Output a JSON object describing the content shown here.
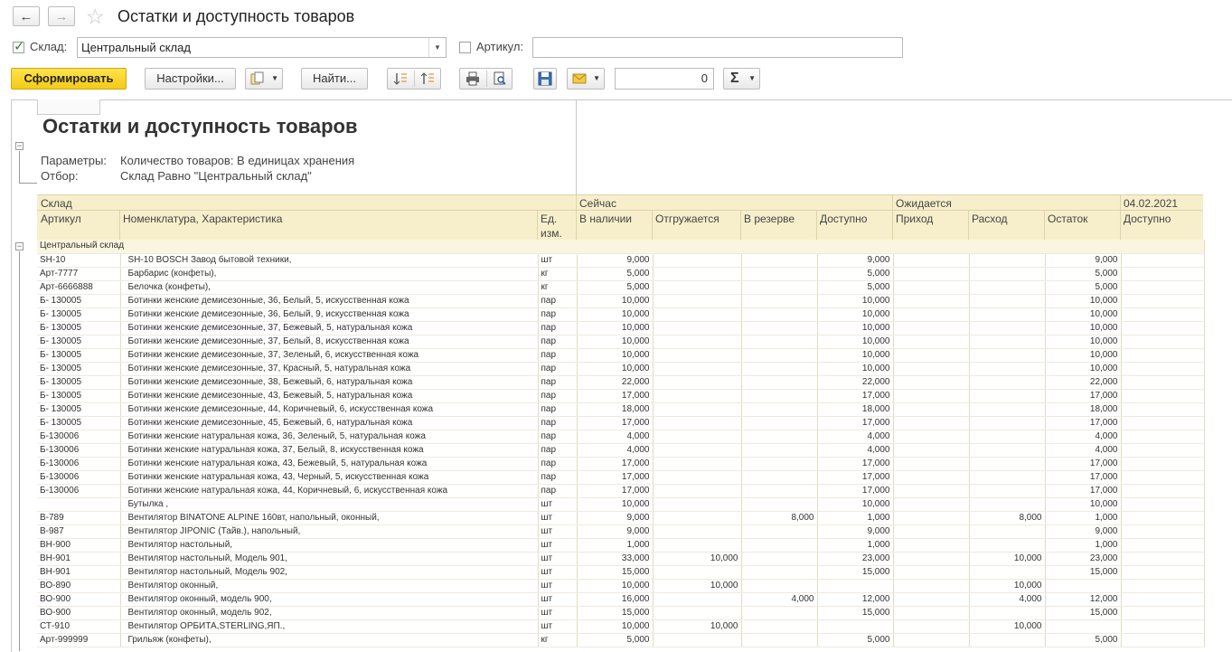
{
  "window": {
    "title": "Остатки и доступность товаров"
  },
  "filters": {
    "warehouse_label": "Склад:",
    "warehouse_value": "Центральный склад",
    "warehouse_checked": true,
    "article_label": "Артикул:",
    "article_value": "",
    "article_checked": false
  },
  "toolbar": {
    "generate": "Сформировать",
    "settings": "Настройки...",
    "find": "Найти...",
    "sum_value": "0",
    "sigma": "Σ"
  },
  "report": {
    "title": "Остатки и доступность товаров",
    "params_label": "Параметры:",
    "params_value": "Количество товаров: В единицах хранения",
    "filter_label": "Отбор:",
    "filter_value": "Склад Равно \"Центральный склад\""
  },
  "header": {
    "warehouse": "Склад",
    "article": "Артикул",
    "nomenclature": "Номенклатура, Характеристика",
    "unit_line1": "Ед.",
    "unit_line2": "изм.",
    "now": "Сейчас",
    "available_now": "В наличии",
    "shipping": "Отгружается",
    "reserve": "В резерве",
    "accessible": "Доступно",
    "expected": "Ожидается",
    "income": "Приход",
    "expense": "Расход",
    "balance": "Остаток",
    "date": "04.02.2021",
    "date_accessible": "Доступно"
  },
  "group_name": "Центральный склад",
  "rows": [
    [
      "SH-10",
      "SH-10 BOSCH Завод бытовой техники,",
      "шт",
      "9,000",
      "",
      "",
      "9,000",
      "",
      "",
      "9,000",
      ""
    ],
    [
      "Арт-7777",
      "Барбарис (конфеты),",
      "кг",
      "5,000",
      "",
      "",
      "5,000",
      "",
      "",
      "5,000",
      ""
    ],
    [
      "Арт-6666888",
      "Белочка (конфеты),",
      "кг",
      "5,000",
      "",
      "",
      "5,000",
      "",
      "",
      "5,000",
      ""
    ],
    [
      "Б- 130005",
      "Ботинки женские демисезонные, 36, Белый, 5, искусственная кожа",
      "пар",
      "10,000",
      "",
      "",
      "10,000",
      "",
      "",
      "10,000",
      ""
    ],
    [
      "Б- 130005",
      "Ботинки женские демисезонные, 36, Белый, 9, искусственная кожа",
      "пар",
      "10,000",
      "",
      "",
      "10,000",
      "",
      "",
      "10,000",
      ""
    ],
    [
      "Б- 130005",
      "Ботинки женские демисезонные, 37, Бежевый, 5, натуральная кожа",
      "пар",
      "10,000",
      "",
      "",
      "10,000",
      "",
      "",
      "10,000",
      ""
    ],
    [
      "Б- 130005",
      "Ботинки женские демисезонные, 37, Белый, 8, искусственная кожа",
      "пар",
      "10,000",
      "",
      "",
      "10,000",
      "",
      "",
      "10,000",
      ""
    ],
    [
      "Б- 130005",
      "Ботинки женские демисезонные, 37, Зеленый, 6, искусственная кожа",
      "пар",
      "10,000",
      "",
      "",
      "10,000",
      "",
      "",
      "10,000",
      ""
    ],
    [
      "Б- 130005",
      "Ботинки женские демисезонные, 37, Красный, 5, натуральная кожа",
      "пар",
      "10,000",
      "",
      "",
      "10,000",
      "",
      "",
      "10,000",
      ""
    ],
    [
      "Б- 130005",
      "Ботинки женские демисезонные, 38, Бежевый, 6, натуральная кожа",
      "пар",
      "22,000",
      "",
      "",
      "22,000",
      "",
      "",
      "22,000",
      ""
    ],
    [
      "Б- 130005",
      "Ботинки женские демисезонные, 43, Бежевый, 5, натуральная кожа",
      "пар",
      "17,000",
      "",
      "",
      "17,000",
      "",
      "",
      "17,000",
      ""
    ],
    [
      "Б- 130005",
      "Ботинки женские демисезонные, 44, Коричневый, 6, искусственная кожа",
      "пар",
      "18,000",
      "",
      "",
      "18,000",
      "",
      "",
      "18,000",
      ""
    ],
    [
      "Б- 130005",
      "Ботинки женские демисезонные, 45, Бежевый, 6, натуральная кожа",
      "пар",
      "17,000",
      "",
      "",
      "17,000",
      "",
      "",
      "17,000",
      ""
    ],
    [
      "Б-130006",
      "Ботинки женские натуральная кожа, 36, Зеленый, 5, натуральная кожа",
      "пар",
      "4,000",
      "",
      "",
      "4,000",
      "",
      "",
      "4,000",
      ""
    ],
    [
      "Б-130006",
      "Ботинки женские натуральная кожа, 37, Белый, 8, искусственная кожа",
      "пар",
      "4,000",
      "",
      "",
      "4,000",
      "",
      "",
      "4,000",
      ""
    ],
    [
      "Б-130006",
      "Ботинки женские натуральная кожа, 43, Бежевый, 5, натуральная кожа",
      "пар",
      "17,000",
      "",
      "",
      "17,000",
      "",
      "",
      "17,000",
      ""
    ],
    [
      "Б-130006",
      "Ботинки женские натуральная кожа, 43, Черный, 5, искусственная кожа",
      "пар",
      "17,000",
      "",
      "",
      "17,000",
      "",
      "",
      "17,000",
      ""
    ],
    [
      "Б-130006",
      "Ботинки женские натуральная кожа, 44, Коричневый, 6, искусственная кожа",
      "пар",
      "17,000",
      "",
      "",
      "17,000",
      "",
      "",
      "17,000",
      ""
    ],
    [
      "",
      "Бутылка ,",
      "шт",
      "10,000",
      "",
      "",
      "10,000",
      "",
      "",
      "10,000",
      ""
    ],
    [
      "В-789",
      "Вентилятор BINATONE ALPINE 160вт, напольный, оконный,",
      "шт",
      "9,000",
      "",
      "8,000",
      "1,000",
      "",
      "8,000",
      "1,000",
      ""
    ],
    [
      "В-987",
      "Вентилятор JIPONIC (Тайв.), напольный,",
      "шт",
      "9,000",
      "",
      "",
      "9,000",
      "",
      "",
      "9,000",
      ""
    ],
    [
      "ВН-900",
      "Вентилятор настольный,",
      "шт",
      "1,000",
      "",
      "",
      "1,000",
      "",
      "",
      "1,000",
      ""
    ],
    [
      "ВН-901",
      "Вентилятор настольный, Модель 901,",
      "шт",
      "33,000",
      "10,000",
      "",
      "23,000",
      "",
      "10,000",
      "23,000",
      ""
    ],
    [
      "ВН-901",
      "Вентилятор настольный, Модель 902,",
      "шт",
      "15,000",
      "",
      "",
      "15,000",
      "",
      "",
      "15,000",
      ""
    ],
    [
      "ВО-890",
      "Вентилятор оконный,",
      "шт",
      "10,000",
      "10,000",
      "",
      "",
      "",
      "10,000",
      "",
      ""
    ],
    [
      "ВО-900",
      "Вентилятор оконный, модель 900,",
      "шт",
      "16,000",
      "",
      "4,000",
      "12,000",
      "",
      "4,000",
      "12,000",
      ""
    ],
    [
      "ВО-900",
      "Вентилятор оконный, модель 902,",
      "шт",
      "15,000",
      "",
      "",
      "15,000",
      "",
      "",
      "15,000",
      ""
    ],
    [
      "СТ-910",
      "Вентилятор ОРБИТА,STERLING,ЯП.,",
      "шт",
      "10,000",
      "10,000",
      "",
      "",
      "",
      "10,000",
      "",
      ""
    ],
    [
      "Арт-999999",
      "Грильяж (конфеты),",
      "кг",
      "5,000",
      "",
      "",
      "5,000",
      "",
      "",
      "5,000",
      ""
    ]
  ]
}
